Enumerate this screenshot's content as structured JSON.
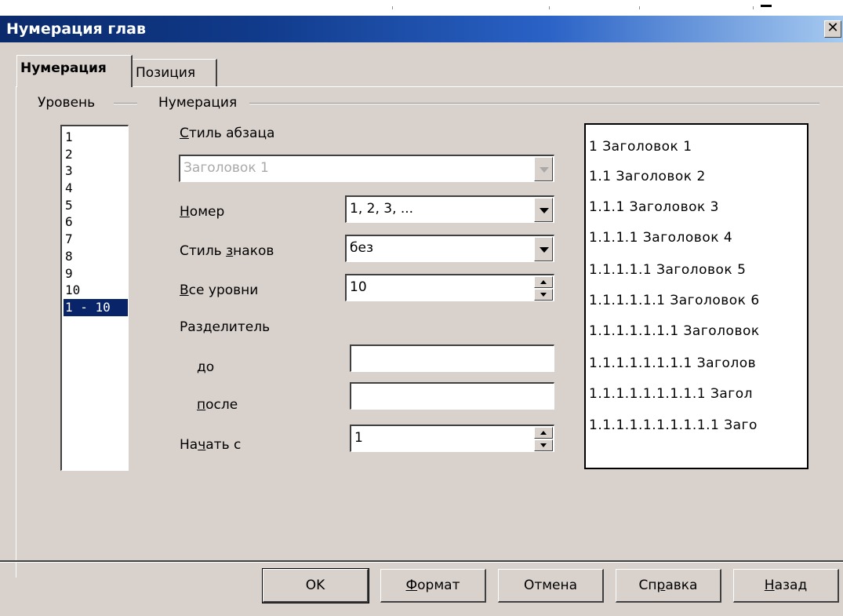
{
  "window": {
    "title": "Нумерация глав",
    "close_glyph": "✕"
  },
  "tabs": [
    {
      "label": "Нумерация",
      "active": true
    },
    {
      "label": "Позиция",
      "active": false
    }
  ],
  "level_section": {
    "label": "Уровень",
    "items": [
      "1",
      "2",
      "3",
      "4",
      "5",
      "6",
      "7",
      "8",
      "9",
      "10",
      "1 - 10"
    ],
    "selected": "1 - 10"
  },
  "numbering_section": {
    "label": "Нумерация",
    "paragraph_style": {
      "label_accel": "С",
      "label_rest": "тиль абзаца",
      "value": "Заголовок 1"
    },
    "number": {
      "label_accel": "Н",
      "label_rest": "омер",
      "value": "1, 2, 3, ..."
    },
    "char_style": {
      "label_pre": "Стиль ",
      "label_accel": "з",
      "label_rest": "наков",
      "value": "без"
    },
    "all_levels": {
      "label_accel": "В",
      "label_rest": "се уровни",
      "value": "10"
    },
    "separator": {
      "label": "Разделитель"
    },
    "before": {
      "label_accel": "д",
      "label_rest": "о",
      "value": ""
    },
    "after": {
      "label_accel": "п",
      "label_rest": "осле",
      "value": ""
    },
    "start_at": {
      "label_pre": "На",
      "label_accel": "ч",
      "label_rest": "ать с",
      "value": "1"
    }
  },
  "preview": {
    "lines": [
      "1 Заголовок 1",
      "1.1 Заголовок 2",
      "1.1.1 Заголовок 3",
      "1.1.1.1 Заголовок 4",
      "1.1.1.1.1 Заголовок 5",
      "1.1.1.1.1.1 Заголовок 6",
      "1.1.1.1.1.1.1 Заголовок",
      "1.1.1.1.1.1.1.1 Заголов",
      "1.1.1.1.1.1.1.1.1 Загол",
      "1.1.1.1.1.1.1.1.1.1 Заго"
    ]
  },
  "buttons": {
    "ok": "OK",
    "format_accel": "Ф",
    "format_rest": "ормат",
    "cancel": "Отмена",
    "help_pre": "Сп",
    "help_accel": "р",
    "help_rest": "авка",
    "back_accel": "Н",
    "back_rest": "азад"
  },
  "colors": {
    "dialog_bg": "#d9d1cb",
    "title_start": "#0b2a6b",
    "title_end": "#a6caf0",
    "selection": "#0a246a"
  }
}
